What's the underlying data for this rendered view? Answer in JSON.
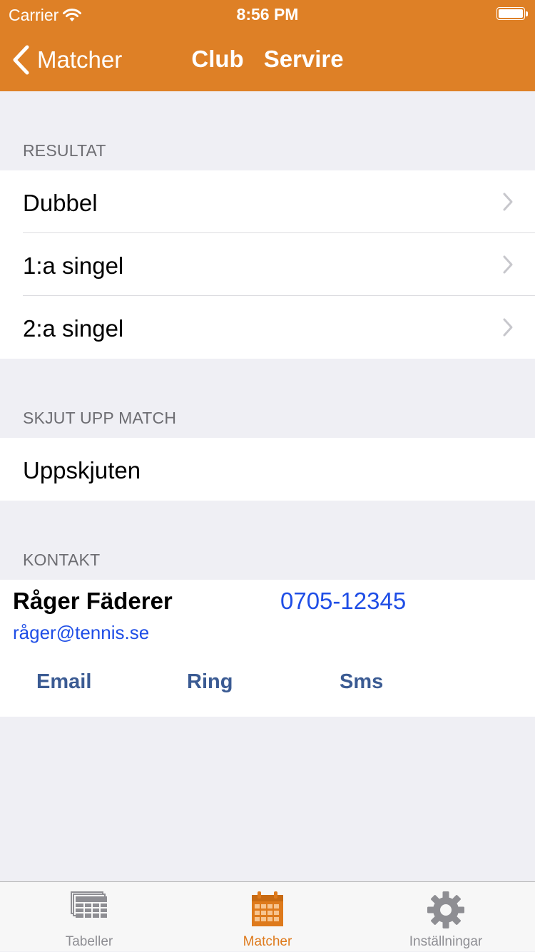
{
  "status_bar": {
    "carrier": "Carrier",
    "time": "8:56 PM"
  },
  "nav": {
    "back_label": "Matcher",
    "title_part1": "Club",
    "title_part2": "Servire"
  },
  "sections": {
    "resultat": {
      "header": "RESULTAT",
      "items": [
        {
          "label": "Dubbel"
        },
        {
          "label": "1:a singel"
        },
        {
          "label": "2:a singel"
        }
      ]
    },
    "skjut_upp": {
      "header": "SKJUT UPP MATCH",
      "items": [
        {
          "label": "Uppskjuten"
        }
      ]
    },
    "kontakt": {
      "header": "KONTAKT",
      "name": "Råger Fäderer",
      "phone": "0705-12345",
      "email": "råger@tennis.se",
      "actions": {
        "email": "Email",
        "ring": "Ring",
        "sms": "Sms"
      }
    }
  },
  "tabbar": {
    "tabs": [
      {
        "label": "Tabeller",
        "icon": "table-icon",
        "active": false
      },
      {
        "label": "Matcher",
        "icon": "calendar-icon",
        "active": true
      },
      {
        "label": "Inställningar",
        "icon": "gear-icon",
        "active": false
      }
    ]
  },
  "colors": {
    "accent": "#de8026",
    "link": "#1f4ee6",
    "action": "#3b5b93",
    "background": "#efeff4"
  }
}
